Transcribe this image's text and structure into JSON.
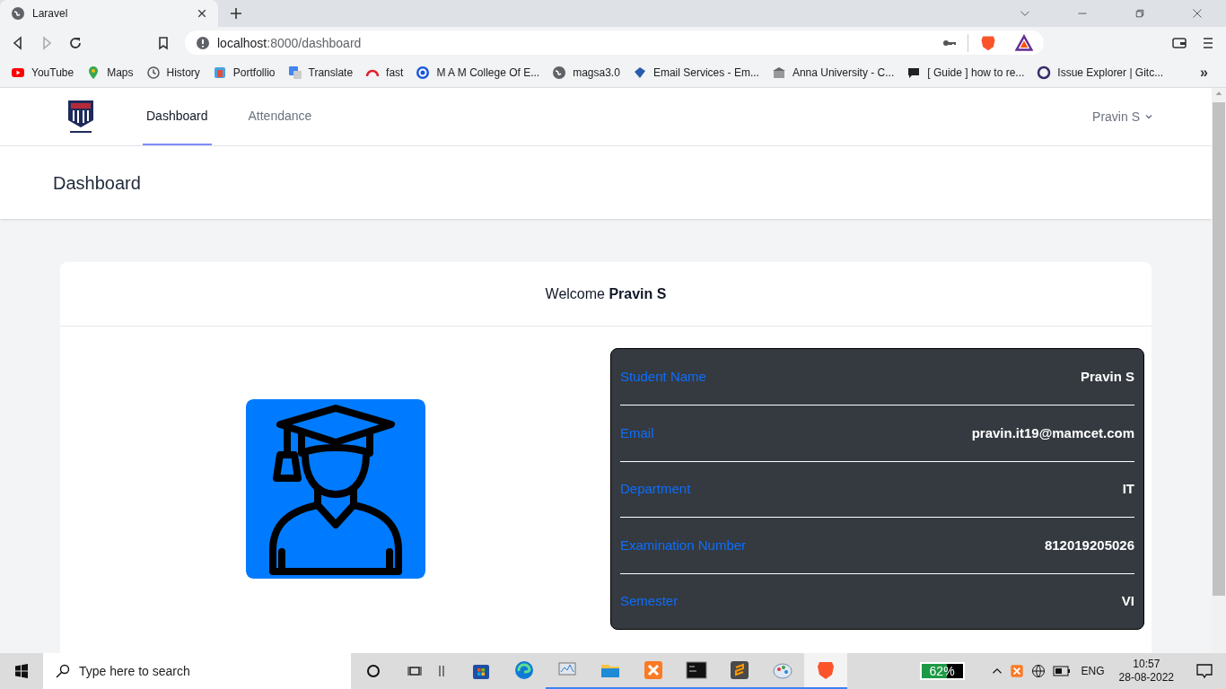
{
  "browser": {
    "tabs": [
      {
        "title": "Laravel",
        "selected": true
      }
    ],
    "url": {
      "host": "localhost",
      "path": ":8000/dashboard"
    },
    "bookmarks": [
      "YouTube",
      "Maps",
      "History",
      "Portfollio",
      "Translate",
      "fast",
      "M A M College Of E...",
      "magsa3.0",
      "Email Services - Em...",
      "Anna University - C...",
      "[ Guide ] how to re...",
      "Issue Explorer | Gitc..."
    ],
    "more": "»"
  },
  "nav": {
    "links": [
      {
        "label": "Dashboard",
        "selected": true
      },
      {
        "label": "Attendance",
        "selected": false
      }
    ],
    "user": "Pravin S"
  },
  "header": {
    "title": "Dashboard"
  },
  "card": {
    "welcome": "Welcome **Pravin S**",
    "details": [
      {
        "label": "Student Name",
        "value": "Pravin S"
      },
      {
        "label": "Email",
        "value": "pravin.it19@mamcet.com"
      },
      {
        "label": "Department",
        "value": "IT"
      },
      {
        "label": "Examination Number",
        "value": "812019205026"
      },
      {
        "label": "Semester",
        "value": "VI"
      }
    ]
  },
  "taskbar": {
    "search": {
      "placeholder": "Type here to search"
    },
    "apps": [
      {
        "running": false,
        "selected": false
      },
      {
        "running": false,
        "selected": false
      },
      {
        "running": true,
        "selected": false
      },
      {
        "running": true,
        "selected": false
      },
      {
        "running": true,
        "selected": false
      },
      {
        "running": true,
        "selected": false
      },
      {
        "running": true,
        "selected": false
      },
      {
        "running": true,
        "selected": false
      },
      {
        "running": true,
        "selected": true
      }
    ],
    "battery": {
      "reading": "62%",
      "level": 0.62
    },
    "language": "ENG",
    "time": "10:57",
    "date": "28-08-2022"
  }
}
